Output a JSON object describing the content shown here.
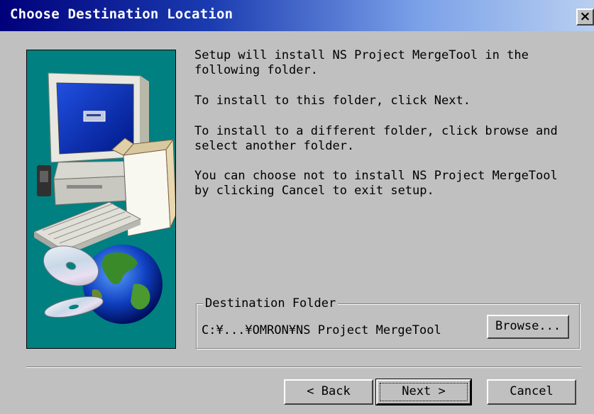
{
  "window": {
    "title": "Choose Destination Location",
    "close_label": "×"
  },
  "body": {
    "paragraphs": [
      "Setup will install NS Project MergeTool in the\nfollowing folder.",
      "To install to this folder, click Next.",
      "To install to a different folder, click browse and\nselect another folder.",
      "You can choose not to install NS Project MergeTool\nby clicking Cancel to exit setup."
    ]
  },
  "destination": {
    "group_label": "Destination Folder",
    "path": "C:¥...¥OMRON¥NS Project MergeTool",
    "browse_label": "Browse..."
  },
  "footer": {
    "back_label": "< Back",
    "next_label": "Next >",
    "cancel_label": "Cancel"
  },
  "colors": {
    "titlebar_start": "#00007a",
    "panel_background": "#008080",
    "dialog_face": "#c0c0c0"
  }
}
